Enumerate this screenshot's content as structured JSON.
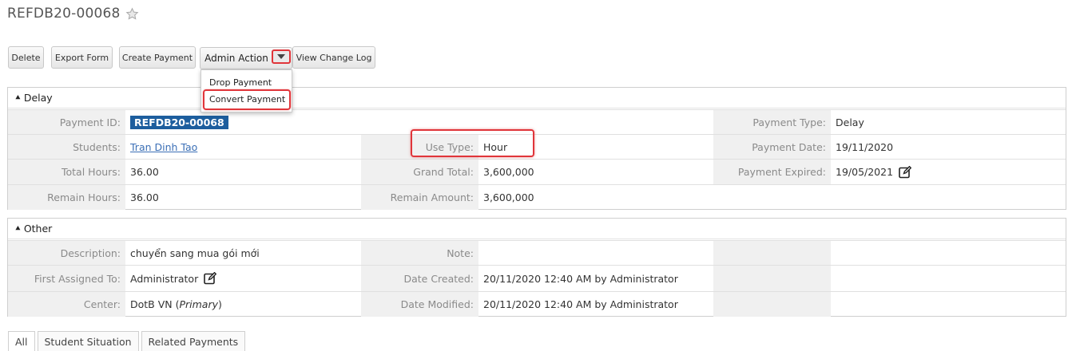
{
  "record": {
    "title": "REFDB20-00068"
  },
  "toolbar": {
    "delete": "Delete",
    "export_form": "Export Form",
    "create_payment": "Create Payment",
    "admin_action": "Admin Action",
    "view_change_log": "View Change Log"
  },
  "admin_menu": {
    "items": [
      "Drop Payment",
      "Convert Payment"
    ]
  },
  "panels": {
    "delay": {
      "heading": "Delay",
      "payment_id_label": "Payment ID:",
      "payment_id": "REFDB20-00068",
      "payment_type_label": "Payment Type:",
      "payment_type": "Delay",
      "students_label": "Students:",
      "students": "Tran Dinh Tao",
      "use_type_label": "Use Type:",
      "use_type": "Hour",
      "payment_date_label": "Payment Date:",
      "payment_date": "19/11/2020",
      "total_hours_label": "Total Hours:",
      "total_hours": "36.00",
      "grand_total_label": "Grand Total:",
      "grand_total": "3,600,000",
      "payment_expired_label": "Payment Expired:",
      "payment_expired": "19/05/2021",
      "remain_hours_label": "Remain Hours:",
      "remain_hours": "36.00",
      "remain_amount_label": "Remain Amount:",
      "remain_amount": "3,600,000"
    },
    "other": {
      "heading": "Other",
      "description_label": "Description:",
      "description": "chuyển sang mua gói mới",
      "note_label": "Note:",
      "note": "",
      "first_assigned_label": "First Assigned To:",
      "first_assigned": "Administrator",
      "date_created_label": "Date Created:",
      "date_created": "20/11/2020 12:40 AM by Administrator",
      "center_label": "Center:",
      "center": "DotB VN",
      "center_role": "Primary",
      "date_modified_label": "Date Modified:",
      "date_modified": "20/11/2020 12:40 AM by Administrator"
    }
  },
  "tabs": [
    "All",
    "Student Situation",
    "Related Payments"
  ],
  "colors": {
    "highlight": "#e0353a",
    "id_badge": "#1d5e9e",
    "link": "#3b6fb6",
    "label_bg": "#f0f0f0"
  },
  "icons": {
    "favorite": "star-icon",
    "edit": "edit-icon",
    "collapse": "chevron-up-double-icon",
    "menu": "caret-down-icon"
  }
}
